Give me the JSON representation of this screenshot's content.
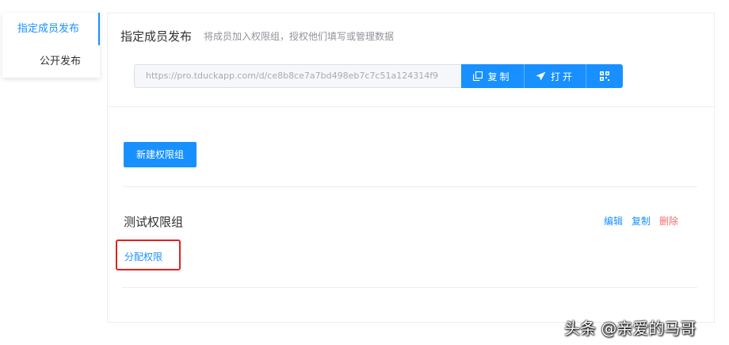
{
  "sidebar": {
    "items": [
      {
        "label": "指定成员发布"
      },
      {
        "label": "公开发布"
      }
    ]
  },
  "header": {
    "title": "指定成员发布",
    "subtitle": "将成员加入权限组，授权他们填写或管理数据"
  },
  "share": {
    "url": "https://pro.tduckapp.com/d/ce8b8ce7a7bd498eb7c7c51a124314f9",
    "copy_label": "复制",
    "open_label": "打开",
    "copy_icon": "copy-icon",
    "open_icon": "send-icon",
    "qr_icon": "qrcode-icon"
  },
  "actions": {
    "new_group_label": "新建权限组"
  },
  "group": {
    "name": "测试权限组",
    "edit_label": "编辑",
    "copy_label": "复制",
    "delete_label": "删除",
    "assign_label": "分配权限"
  },
  "watermark": {
    "text": "头条 @亲爱的马哥"
  },
  "colors": {
    "primary": "#1890ff",
    "danger": "#f56c6c",
    "highlight": "#e02020"
  }
}
